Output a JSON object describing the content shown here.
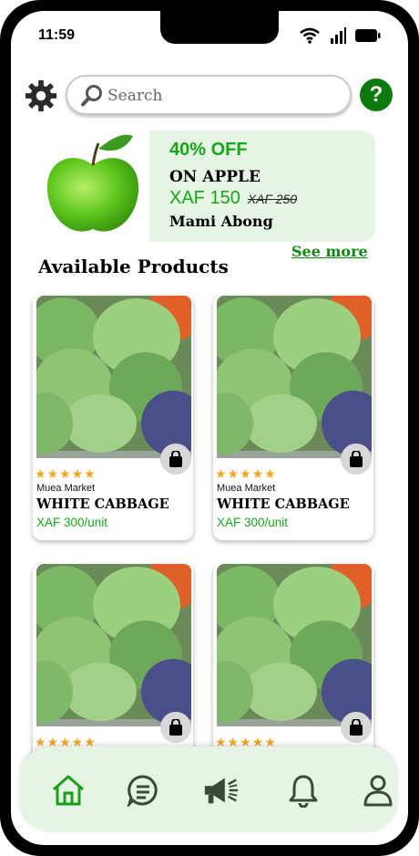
{
  "status_bar": {
    "time": "11:59"
  },
  "search": {
    "placeholder": "Search"
  },
  "help": {
    "label": "?"
  },
  "promo": {
    "discount": "40% OFF",
    "title": "ON APPLE",
    "price": "XAF 150",
    "old_price": "XAF 250",
    "seller": "Mami Abong"
  },
  "section": {
    "title": "Available Products",
    "see_more": "See more"
  },
  "products": [
    {
      "market": "Muea Market",
      "name": "WHITE CABBAGE",
      "price": "XAF 300/unit",
      "stars": "★★★★★"
    },
    {
      "market": "Muea Market",
      "name": "WHITE CABBAGE",
      "price": "XAF 300/unit",
      "stars": "★★★★★"
    },
    {
      "stars": "★★★★★"
    },
    {
      "stars": "★★★★★"
    }
  ],
  "nav": [
    "home-icon",
    "chat-icon",
    "megaphone-icon",
    "bell-icon",
    "profile-icon"
  ],
  "colors": {
    "accent": "#16a816",
    "dark_green": "#0d7a0d",
    "light_green_bg": "#e5f4e4",
    "star": "#f5a623"
  }
}
